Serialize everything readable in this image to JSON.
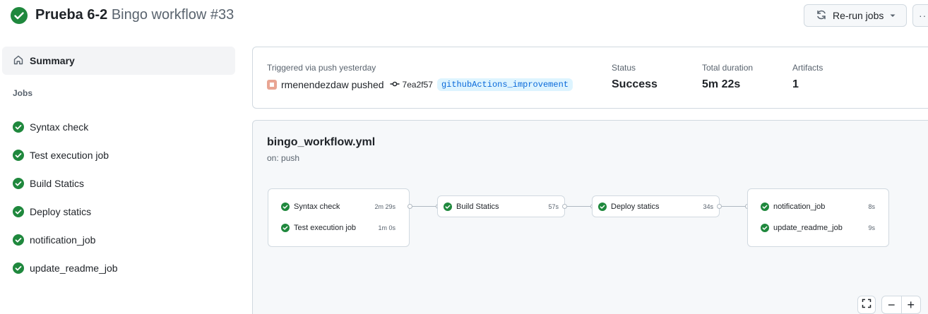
{
  "header": {
    "workflow_name": "Prueba 6-2",
    "run_title": "Bingo workflow #33",
    "rerun_label": "Re-run jobs",
    "more_label": "···"
  },
  "sidebar": {
    "summary_label": "Summary",
    "jobs_heading": "Jobs",
    "jobs": [
      {
        "label": "Syntax check"
      },
      {
        "label": "Test execution job"
      },
      {
        "label": "Build Statics"
      },
      {
        "label": "Deploy statics"
      },
      {
        "label": "notification_job"
      },
      {
        "label": "update_readme_job"
      }
    ]
  },
  "summary": {
    "triggered_label": "Triggered via push yesterday",
    "actor": "rmenendezdaw pushed",
    "commit_sha": "7ea2f57",
    "branch": "githubActions_improvement",
    "status_label": "Status",
    "status_value": "Success",
    "duration_label": "Total duration",
    "duration_value": "5m 22s",
    "artifacts_label": "Artifacts",
    "artifacts_value": "1"
  },
  "graph": {
    "file": "bingo_workflow.yml",
    "trigger": "on: push",
    "nodes": [
      {
        "label": "Syntax check",
        "duration": "2m 29s"
      },
      {
        "label": "Test execution job",
        "duration": "1m 0s"
      },
      {
        "label": "Build Statics",
        "duration": "57s"
      },
      {
        "label": "Deploy statics",
        "duration": "34s"
      },
      {
        "label": "notification_job",
        "duration": "8s"
      },
      {
        "label": "update_readme_job",
        "duration": "9s"
      }
    ],
    "zoom_out": "−",
    "zoom_in": "+"
  },
  "colors": {
    "success": "#1f883d",
    "link": "#0969da",
    "branch_bg": "#ddf4ff"
  },
  "icons": {
    "status": "check-circle-icon",
    "summary": "home-icon",
    "rerun": "sync-icon",
    "commit": "git-commit-icon",
    "fullscreen": "fullscreen-icon"
  }
}
